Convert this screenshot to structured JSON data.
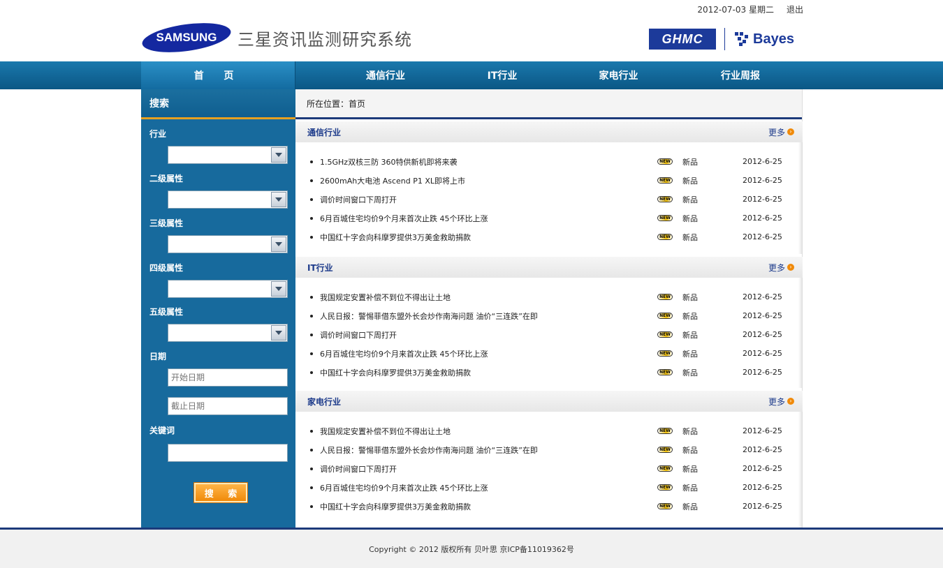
{
  "header": {
    "date": "2012-07-03",
    "weekday": "星期二",
    "logout": "退出",
    "samsung_logo": "SAMSUNG",
    "system_title": "三星资讯监测研究系统",
    "ghmc_logo": "GHMC",
    "bayes_logo": "Bayes"
  },
  "nav": {
    "home": "首 页",
    "items": [
      "通信行业",
      "IT行业",
      "家电行业",
      "行业周报"
    ]
  },
  "sidebar": {
    "title": "搜索",
    "industry_label": "行业",
    "level2_label": "二级属性",
    "level3_label": "三级属性",
    "level4_label": "四级属性",
    "level5_label": "五级属性",
    "date_label": "日期",
    "start_date_placeholder": "开始日期",
    "end_date_placeholder": "截止日期",
    "keyword_label": "关键词",
    "search_button": "搜 索"
  },
  "breadcrumb": "所在位置：首页",
  "sections": [
    {
      "title": "通信行业",
      "more": "更多",
      "rows": [
        {
          "title": "1.5GHz双核三防 360特供新机即将来袭",
          "badge": "new",
          "tag": "新品",
          "date": "2012-6-25"
        },
        {
          "title": "2600mAh大电池 Ascend P1 XL即将上市",
          "badge": "new",
          "tag": "新品",
          "date": "2012-6-25"
        },
        {
          "title": "调价时间窗口下周打开",
          "badge": "new",
          "tag": "新品",
          "date": "2012-6-25"
        },
        {
          "title": "6月百城住宅均价9个月来首次止跌 45个环比上涨",
          "badge": "new",
          "tag": "新品",
          "date": "2012-6-25"
        },
        {
          "title": "中国红十字会向科摩罗提供3万美金救助捐款",
          "badge": "new",
          "tag": "新品",
          "date": "2012-6-25"
        }
      ]
    },
    {
      "title": "IT行业",
      "more": "更多",
      "rows": [
        {
          "title": "我国规定安置补偿不到位不得出让土地",
          "badge": "new",
          "tag": "新品",
          "date": "2012-6-25"
        },
        {
          "title": "人民日报：警惕菲借东盟外长会炒作南海问题 油价“三连跌”在即",
          "badge": "new",
          "tag": "新品",
          "date": "2012-6-25"
        },
        {
          "title": "调价时间窗口下周打开",
          "badge": "new",
          "tag": "新品",
          "date": "2012-6-25"
        },
        {
          "title": "6月百城住宅均价9个月来首次止跌 45个环比上涨",
          "badge": "new",
          "tag": "新品",
          "date": "2012-6-25"
        },
        {
          "title": "中国红十字会向科摩罗提供3万美金救助捐款",
          "badge": "new",
          "tag": "新品",
          "date": "2012-6-25"
        }
      ]
    },
    {
      "title": "家电行业",
      "more": "更多",
      "rows": [
        {
          "title": "我国规定安置补偿不到位不得出让土地",
          "badge": "new",
          "tag": "新品",
          "date": "2012-6-25"
        },
        {
          "title": "人民日报：警惕菲借东盟外长会炒作南海问题 油价“三连跌”在即",
          "badge": "new",
          "tag": "新品",
          "date": "2012-6-25"
        },
        {
          "title": "调价时间窗口下周打开",
          "badge": "new",
          "tag": "新品",
          "date": "2012-6-25"
        },
        {
          "title": "6月百城住宅均价9个月来首次止跌 45个环比上涨",
          "badge": "new",
          "tag": "新品",
          "date": "2012-6-25"
        },
        {
          "title": "中国红十字会向科摩罗提供3万美金救助捐款",
          "badge": "new",
          "tag": "新品",
          "date": "2012-6-25"
        }
      ]
    }
  ],
  "footer": {
    "text": "Copyright © 2012  版权所有 贝叶思 京ICP备11019362号"
  },
  "colors": {
    "nav_blue": "#0b5785",
    "sidebar_blue": "#176a9d",
    "accent_orange": "#f08a0a",
    "title_navy": "#1c3a8a"
  }
}
